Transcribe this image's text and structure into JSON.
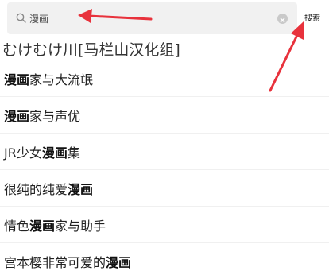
{
  "search": {
    "query": "漫画",
    "button_label": "搜索"
  },
  "partial_row_text": "むけむけ川[马栏山汉化组]",
  "results": [
    {
      "parts": [
        {
          "text": "漫画",
          "bold": true
        },
        {
          "text": "家与大流氓",
          "bold": false
        }
      ]
    },
    {
      "parts": [
        {
          "text": "漫画",
          "bold": true
        },
        {
          "text": "家与声优",
          "bold": false
        }
      ]
    },
    {
      "parts": [
        {
          "text": "JR少女",
          "bold": false
        },
        {
          "text": "漫画",
          "bold": true
        },
        {
          "text": "集",
          "bold": false
        }
      ]
    },
    {
      "parts": [
        {
          "text": "很纯的纯爱",
          "bold": false
        },
        {
          "text": "漫画",
          "bold": true
        }
      ]
    },
    {
      "parts": [
        {
          "text": "情色",
          "bold": false
        },
        {
          "text": "漫画",
          "bold": true
        },
        {
          "text": "家与助手",
          "bold": false
        }
      ]
    },
    {
      "parts": [
        {
          "text": "宫本樱非常可爱的",
          "bold": false
        },
        {
          "text": "漫画",
          "bold": true
        }
      ]
    }
  ],
  "colors": {
    "annotation_arrow": "#e8323c",
    "search_bg": "#f1f1f1"
  },
  "icons": {
    "search": "search-icon",
    "clear": "close-circle-icon"
  }
}
